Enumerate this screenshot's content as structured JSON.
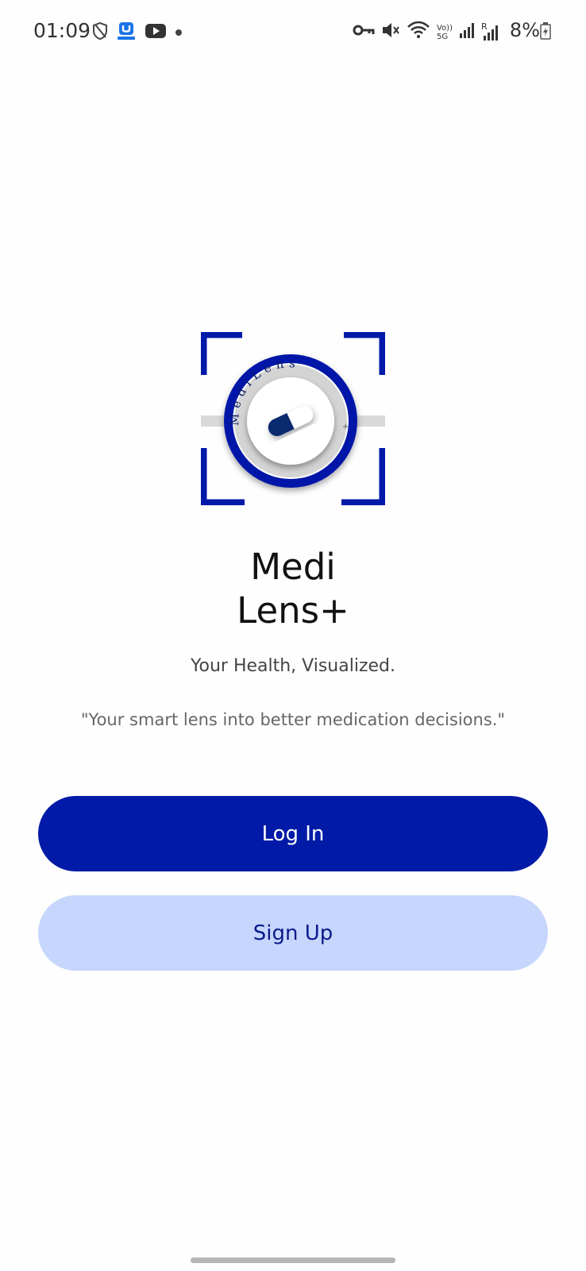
{
  "status_bar": {
    "time": "01:09",
    "battery_text": "8%",
    "left_icons": [
      "shield-icon",
      "app-notification-icon",
      "youtube-icon",
      "dot-icon"
    ],
    "right_icons": [
      "vpn-key-icon",
      "mute-icon",
      "wifi-icon",
      "volte-5g-icon",
      "signal-icon",
      "roaming-signal-icon",
      "battery-icon"
    ],
    "volte_label": "Vo))",
    "network_label": "5G",
    "roaming_label": "R"
  },
  "logo": {
    "ring_text": "MediLens",
    "plus": "+",
    "brand_color": "#0019a8"
  },
  "app": {
    "title_line1": "Medi",
    "title_line2": "Lens+",
    "tagline": "Your Health, Visualized.",
    "quote": "\"Your smart lens into better medication decisions.\""
  },
  "buttons": {
    "login_label": "Log In",
    "signup_label": "Sign Up"
  },
  "colors": {
    "primary": "#011aa7",
    "secondary": "#c6d6fc",
    "secondary_text": "#0a1a8a"
  }
}
